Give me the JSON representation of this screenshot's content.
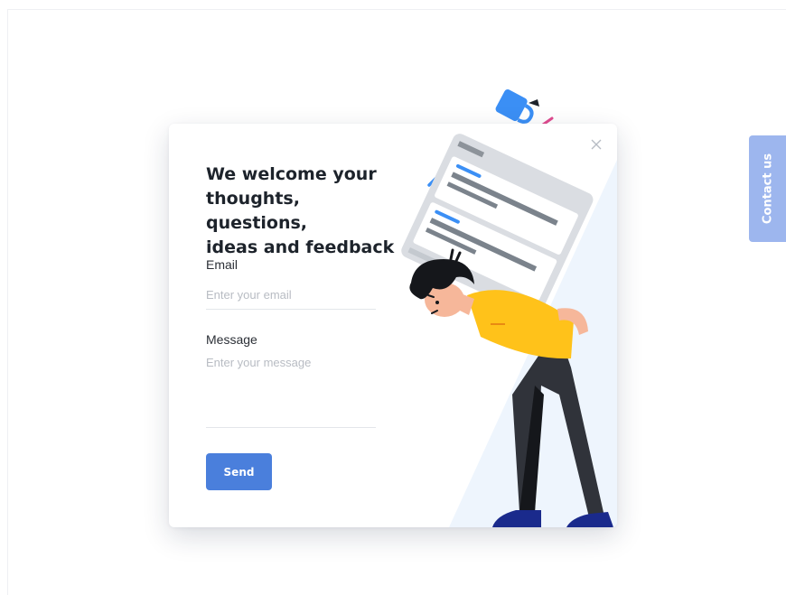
{
  "modal": {
    "heading": "We welcome your\nthoughts, questions,\nideas and feedback",
    "email_label": "Email",
    "email_placeholder": "Enter your email",
    "email_value": "",
    "message_label": "Message",
    "message_placeholder": "Enter your message",
    "message_value": "",
    "send_label": "Send",
    "close_icon": "close-icon"
  },
  "contact_tab": {
    "label": "Contact us"
  },
  "colors": {
    "accent": "#4a7fdc",
    "tab": "#9db6ee",
    "heading": "#1d232b"
  }
}
